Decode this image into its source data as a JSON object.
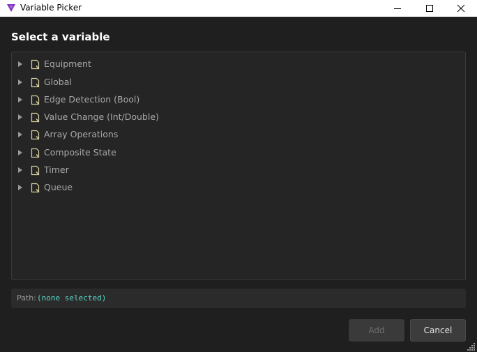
{
  "window": {
    "title": "Variable Picker",
    "app_icon": "v-logo-icon",
    "controls": {
      "minimize": "minimize-icon",
      "maximize": "maximize-icon",
      "close": "close-icon"
    }
  },
  "heading": "Select a variable",
  "tree": {
    "items": [
      {
        "label": "Equipment",
        "icon": "folder-document-icon"
      },
      {
        "label": "Global",
        "icon": "folder-document-icon"
      },
      {
        "label": "Edge Detection (Bool)",
        "icon": "folder-document-icon"
      },
      {
        "label": "Value Change (Int/Double)",
        "icon": "folder-document-icon"
      },
      {
        "label": "Array Operations",
        "icon": "folder-document-icon"
      },
      {
        "label": "Composite State",
        "icon": "folder-document-icon"
      },
      {
        "label": "Timer",
        "icon": "folder-document-icon"
      },
      {
        "label": "Queue",
        "icon": "folder-document-icon"
      }
    ]
  },
  "path": {
    "label": "Path:",
    "value": "(none selected)"
  },
  "buttons": {
    "add": "Add",
    "cancel": "Cancel"
  },
  "colors": {
    "accent_path": "#5ad6c6",
    "app_icon": "#7b2fbf",
    "tree_icon": "#d8d0a0"
  }
}
